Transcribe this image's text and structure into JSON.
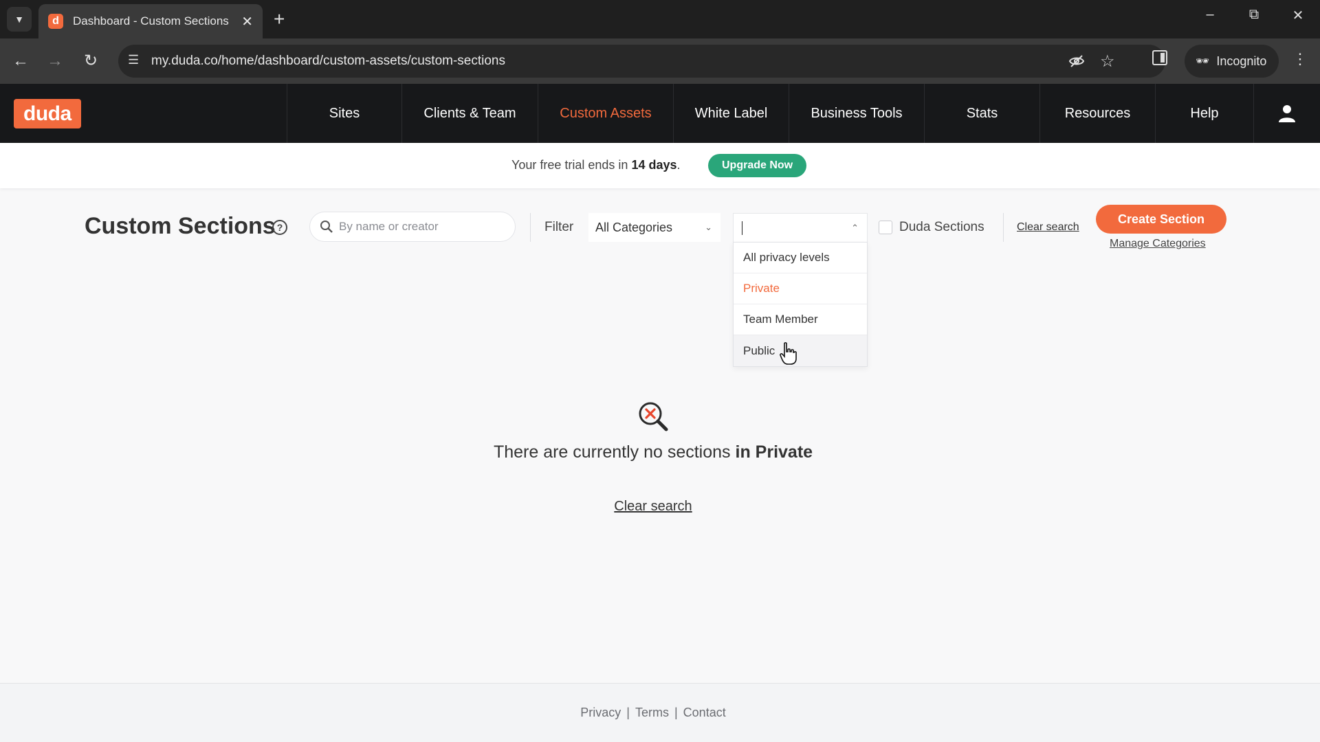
{
  "browser": {
    "tab_title": "Dashboard - Custom Sections |",
    "favicon_letter": "d",
    "url": "my.duda.co/home/dashboard/custom-assets/custom-sections",
    "incognito_label": "Incognito"
  },
  "header": {
    "logo": "duda",
    "nav": [
      {
        "label": "Sites",
        "active": false
      },
      {
        "label": "Clients & Team",
        "active": false
      },
      {
        "label": "Custom Assets",
        "active": true
      },
      {
        "label": "White Label",
        "active": false
      },
      {
        "label": "Business Tools",
        "active": false
      },
      {
        "label": "Stats",
        "active": false
      },
      {
        "label": "Resources",
        "active": false
      },
      {
        "label": "Help",
        "active": false
      }
    ]
  },
  "trial": {
    "text_before": "Your free trial ends in ",
    "days": "14 days",
    "text_after": ".",
    "upgrade_label": "Upgrade Now"
  },
  "toolbar": {
    "title": "Custom Sections",
    "help_glyph": "?",
    "search_placeholder": "By name or creator",
    "search_value": "",
    "filter_label": "Filter",
    "category_value": "All Categories",
    "privacy_value": "",
    "privacy_options": [
      {
        "label": "All privacy levels",
        "selected": false
      },
      {
        "label": "Private",
        "selected": true
      },
      {
        "label": "Team Member",
        "selected": false
      },
      {
        "label": "Public",
        "selected": false
      }
    ],
    "duda_sections_label": "Duda Sections",
    "duda_sections_checked": false,
    "clear_search_label": "Clear search",
    "create_label": "Create Section",
    "manage_categories_label": "Manage Categories"
  },
  "empty_state": {
    "message_prefix": "There are currently no sections ",
    "message_bold": "in Private",
    "clear_search_label": "Clear search"
  },
  "footer": {
    "links": [
      "Privacy",
      "Terms",
      "Contact"
    ]
  },
  "colors": {
    "brand": "#f26a3d",
    "upgrade": "#2aa67a",
    "header_bg": "#17181a"
  }
}
